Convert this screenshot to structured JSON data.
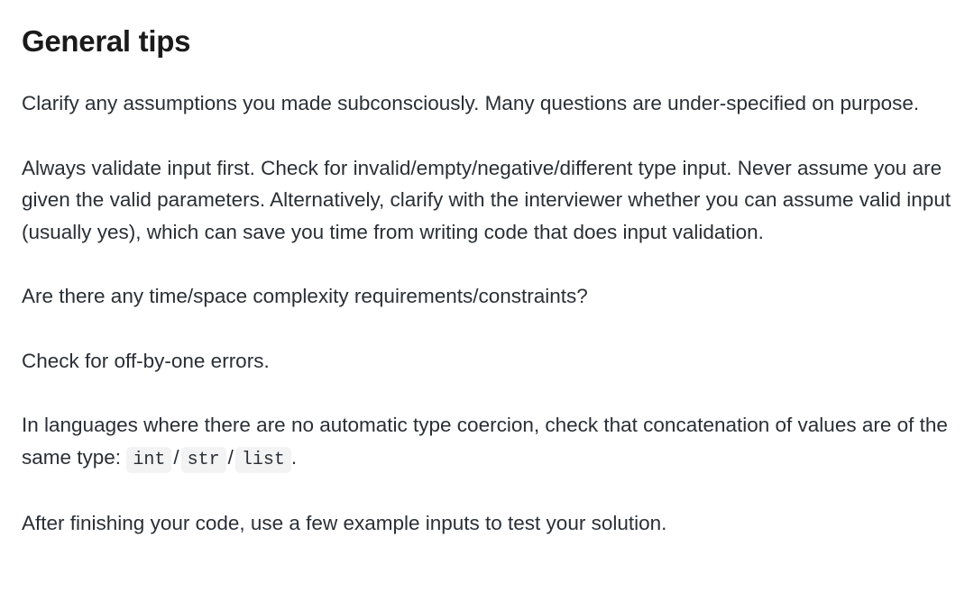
{
  "heading": "General tips",
  "tips": {
    "p1": "Clarify any assumptions you made subconsciously. Many questions are under-specified on purpose.",
    "p2": "Always validate input first. Check for invalid/empty/negative/different type input. Never assume you are given the valid parameters. Alternatively, clarify with the interviewer whether you can assume valid input (usually yes), which can save you time from writing code that does input validation.",
    "p3": "Are there any time/space complexity requirements/constraints?",
    "p4": "Check for off-by-one errors.",
    "p5_prefix": "In languages where there are no automatic type coercion, check that concatenation of values are of the same type: ",
    "p5_code1": "int",
    "p5_sep": "/",
    "p5_code2": "str",
    "p5_code3": "list",
    "p5_suffix": ".",
    "p6": "After finishing your code, use a few example inputs to test your solution."
  }
}
